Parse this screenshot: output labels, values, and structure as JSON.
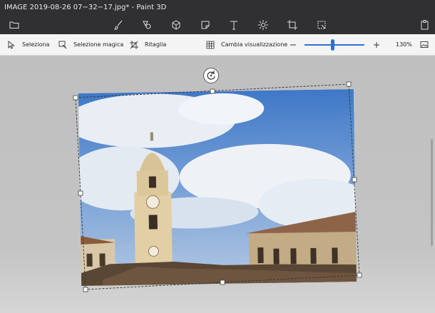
{
  "window": {
    "title": "IMAGE 2019-08-26 07−32−17.jpg* - Paint 3D"
  },
  "toolbar": {
    "icons": [
      "folder-icon",
      "brush-icon",
      "2d-shapes-icon",
      "3d-shapes-icon",
      "stickers-icon",
      "text-icon",
      "effects-icon",
      "canvas-icon",
      "magic-select-icon",
      "paste-icon"
    ]
  },
  "commandbar": {
    "select_label": "Seleziona",
    "magic_select_label": "Selezione magica",
    "crop_label": "Ritaglia",
    "change_view_label": "Cambia visualizzazione",
    "zoom_percent": "130%",
    "zoom_slider_fraction": 0.47
  },
  "colors": {
    "accent": "#2f6fd6",
    "titlebar": "#303033",
    "commandbar": "#f4f4f4",
    "canvas": "#c4c4c4"
  }
}
